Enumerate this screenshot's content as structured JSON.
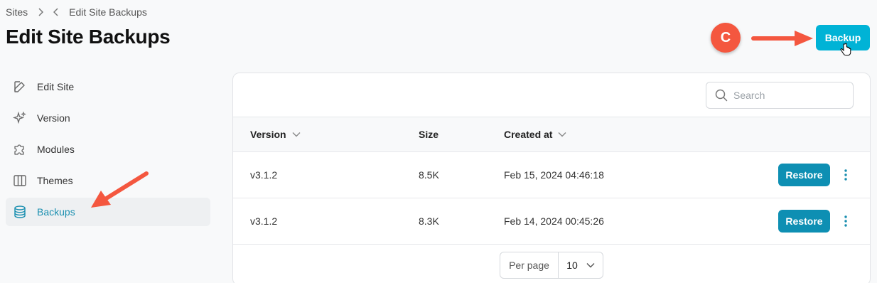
{
  "breadcrumb": {
    "root": "Sites",
    "current": "Edit Site Backups"
  },
  "page": {
    "title": "Edit Site Backups"
  },
  "header": {
    "backup_label": "Backup",
    "step_badge": "C"
  },
  "sidebar": {
    "items": [
      {
        "label": "Edit Site",
        "icon": "edit-icon"
      },
      {
        "label": "Version",
        "icon": "sparkle-icon"
      },
      {
        "label": "Modules",
        "icon": "puzzle-icon"
      },
      {
        "label": "Themes",
        "icon": "columns-icon"
      },
      {
        "label": "Backups",
        "icon": "database-icon",
        "active": true
      }
    ]
  },
  "search": {
    "placeholder": "Search"
  },
  "table": {
    "columns": [
      {
        "label": "Version",
        "sortable": true
      },
      {
        "label": "Size",
        "sortable": false
      },
      {
        "label": "Created at",
        "sortable": true
      }
    ],
    "rows": [
      {
        "version": "v3.1.2",
        "size": "8.5K",
        "created_at": "Feb 15, 2024 04:46:18",
        "action": "Restore"
      },
      {
        "version": "v3.1.2",
        "size": "8.3K",
        "created_at": "Feb 14, 2024 00:45:26",
        "action": "Restore"
      }
    ]
  },
  "pagination": {
    "per_page_label": "Per page",
    "per_page_value": "10"
  },
  "colors": {
    "primary": "#00b3d6",
    "restore": "#0e8fb3",
    "annotation": "#f4573f",
    "active_text": "#1a8fb0"
  }
}
